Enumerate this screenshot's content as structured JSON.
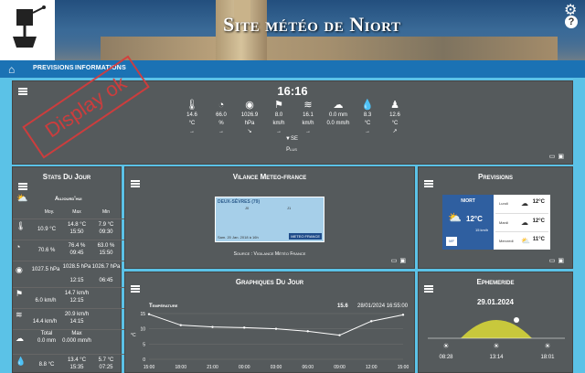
{
  "header": {
    "title": "Site météo de Niort",
    "settings_icon": "gear-icon",
    "help_icon": "help-icon",
    "help_glyph": "?"
  },
  "nav": {
    "home_icon": "home-icon",
    "items": [
      "PREVISIONS",
      "INFORMATIONS"
    ]
  },
  "current": {
    "time": "16:16",
    "metrics": [
      {
        "icon": "thermometer-icon",
        "value": "14.6",
        "unit": "°C",
        "trend": "→"
      },
      {
        "icon": "humidity-icon",
        "value": "66.0",
        "unit": "%",
        "trend": "→"
      },
      {
        "icon": "barometer-icon",
        "value": "1026.9",
        "unit": "hPa",
        "trend": "↘"
      },
      {
        "icon": "wind-icon",
        "value": "8.0",
        "unit": "km/h",
        "trend": "→"
      },
      {
        "icon": "gust-icon",
        "value": "16.1",
        "unit": "km/h",
        "trend": "→"
      },
      {
        "icon": "rain-icon",
        "value": "0.0 mm",
        "unit": "0.0 mm/h",
        "trend": ""
      },
      {
        "icon": "dewpoint-icon",
        "value": "8.3",
        "unit": "°C",
        "trend": "→"
      },
      {
        "icon": "feels-like-icon",
        "value": "12.6",
        "unit": "°C",
        "trend": "↗"
      }
    ],
    "wind_dir": "▼SE",
    "plus_label": "Plus"
  },
  "stamp": "Display ok",
  "stats": {
    "title": "Stats Du Jour",
    "subtitle": "Aujourd'hui",
    "headers": [
      "Moy.",
      "Max",
      "Min"
    ],
    "rows": [
      {
        "icon": "thermometer-icon",
        "moy": "10.9 °C",
        "max": "14.8 °C",
        "max_t": "15:50",
        "min": "7.9 °C",
        "min_t": "09:30"
      },
      {
        "icon": "humidity-icon",
        "moy": "70.6 %",
        "max": "76.4 %",
        "max_t": "09:45",
        "min": "63.0 %",
        "min_t": "15:50"
      },
      {
        "icon": "barometer-icon",
        "moy": "1027.5 hPa",
        "max": "1028.5 hPa",
        "max_t": "12:15",
        "min": "1026.7 hPa",
        "min_t": "06:45"
      },
      {
        "icon": "wind-icon",
        "moy": "6.0 km/h",
        "max": "14.7 km/h",
        "max_t": "12:15",
        "min": "",
        "min_t": ""
      },
      {
        "icon": "gust-icon",
        "moy": "14.4 km/h",
        "max": "20.9 km/h",
        "max_t": "14:15",
        "min": "",
        "min_t": ""
      },
      {
        "icon": "rain-icon",
        "moy_label": "Total",
        "moy": "0.0 mm",
        "max_label": "Max",
        "max": "0.000 mm/h",
        "max_t": "",
        "min": "",
        "min_t": ""
      },
      {
        "icon": "dewpoint-icon",
        "moy": "8.8 °C",
        "max": "13.4 °C",
        "max_t": "15:35",
        "min": "5.7 °C",
        "min_t": "07:25"
      }
    ]
  },
  "vigilance": {
    "title": "Vilance Meteo-france",
    "dept": "DEUX-SÈVRES (79)",
    "j0": "J0",
    "j1": "J1",
    "date": "Sam. 20 Jan. 2018 à 16h",
    "brand": "METEO FRANCE",
    "caption": "Source : Vigilance Météo France"
  },
  "previsions": {
    "title": "Previsions",
    "city": "NIORT",
    "temp": "12°C",
    "wind": "15 km/h",
    "days": [
      {
        "name": "Lundi",
        "temp": "12°C"
      },
      {
        "name": "Mardi",
        "temp": "12°C"
      },
      {
        "name": "Mercredi",
        "temp": "11°C"
      }
    ]
  },
  "graph": {
    "title": "Graphiques Du Jour",
    "series_title": "Température",
    "current_value": "15.6",
    "date": "28/01/2024 16:55:00"
  },
  "chart_data": {
    "type": "line",
    "title": "Température",
    "ylabel": "°C",
    "ylim": [
      0,
      15
    ],
    "yticks": [
      "15",
      "10",
      "5",
      "0"
    ],
    "x": [
      "15:00",
      "18:00",
      "21:00",
      "00:00",
      "03:00",
      "06:00",
      "09:00",
      "12:00",
      "15:00"
    ],
    "values": [
      14.8,
      11.2,
      10.6,
      10.4,
      10.0,
      9.2,
      7.9,
      12.5,
      14.6
    ]
  },
  "ephemeride": {
    "title": "Ephemeride",
    "date": "29.01.2024",
    "sunrise": "08:28",
    "noon": "13:14",
    "sunset": "18:01"
  },
  "colors": {
    "background": "#5bc2e7",
    "panel": "#555a5c",
    "nav": "#1b72b4",
    "stamp": "#d93a3a",
    "sun_arc": "#c8c83c"
  }
}
